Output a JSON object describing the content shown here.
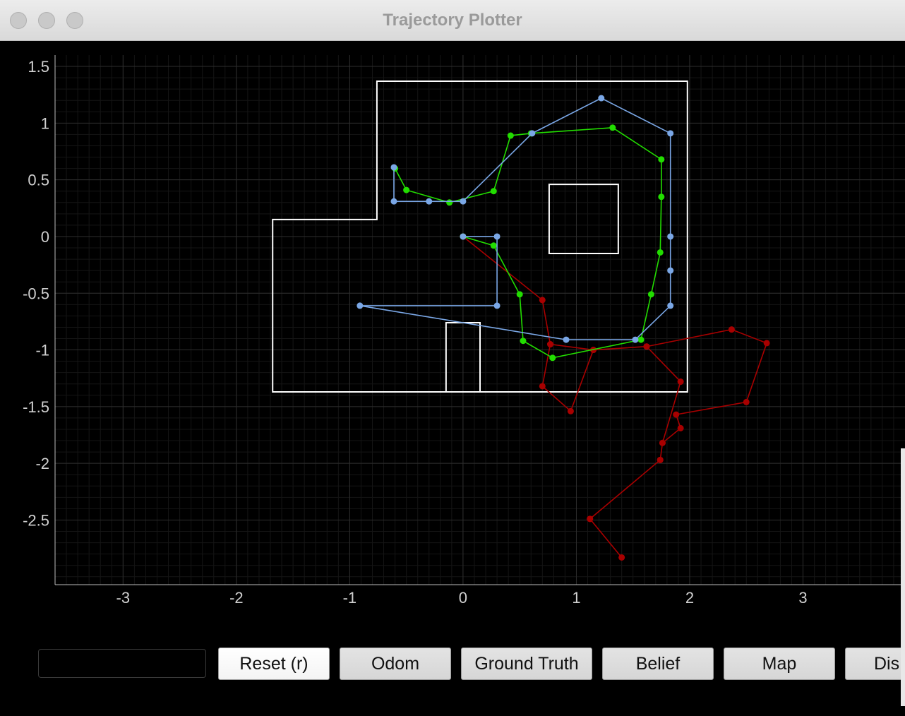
{
  "window": {
    "title": "Trajectory Plotter"
  },
  "status_field": {
    "value": ""
  },
  "buttons": [
    {
      "name": "reset-button",
      "label": "Reset (r)"
    },
    {
      "name": "odom-button",
      "label": "Odom"
    },
    {
      "name": "ground-truth-button",
      "label": "Ground Truth"
    },
    {
      "name": "belief-button",
      "label": "Belief"
    },
    {
      "name": "map-button",
      "label": "Map"
    },
    {
      "name": "dist-button",
      "label": "Dis"
    }
  ],
  "colors": {
    "background": "#000000",
    "grid": "#2e2e2e",
    "axis": "#bdbdbd",
    "odom": "#a80000",
    "ground_truth": "#22dd00",
    "belief": "#7aa7e6",
    "map": "#ffffff"
  },
  "chart_data": {
    "type": "line",
    "xlim": [
      -3.6,
      3.9
    ],
    "ylim": [
      -3.07,
      1.6
    ],
    "x_ticks": [
      -3,
      -2,
      -1,
      0,
      1,
      2,
      3
    ],
    "y_ticks": [
      1.5,
      1,
      0.5,
      0,
      -0.5,
      -1,
      -1.5,
      -2,
      -2.5
    ],
    "x_tick_labels": [
      "-3",
      "-2",
      "-1",
      "0",
      "1",
      "2",
      "3"
    ],
    "y_tick_labels": [
      "1.5",
      "1",
      "0.5",
      "0",
      "-0.5",
      "-1",
      "-1.5",
      "-2",
      "-2.5"
    ],
    "grid": true,
    "series": [
      {
        "key": "odom",
        "points": [
          [
            0,
            0
          ],
          [
            0.7,
            -0.56
          ],
          [
            0.77,
            -0.95
          ],
          [
            1.15,
            -1.0
          ],
          [
            1.62,
            -0.97
          ],
          [
            2.37,
            -0.82
          ],
          [
            2.68,
            -0.94
          ],
          [
            2.5,
            -1.46
          ],
          [
            1.88,
            -1.57
          ],
          [
            1.92,
            -1.69
          ],
          [
            1.76,
            -1.82
          ],
          [
            1.74,
            -1.97
          ],
          [
            1.12,
            -2.49
          ],
          [
            1.4,
            -2.83
          ],
          [
            1.12,
            -2.49
          ],
          [
            1.74,
            -1.97
          ],
          [
            1.76,
            -1.82
          ],
          [
            1.92,
            -1.28
          ],
          [
            1.62,
            -0.97
          ],
          [
            1.15,
            -1.0
          ],
          [
            0.95,
            -1.54
          ],
          [
            0.7,
            -1.32
          ],
          [
            0.77,
            -0.95
          ]
        ]
      },
      {
        "key": "ground_truth",
        "points": [
          [
            0,
            0
          ],
          [
            0.27,
            -0.08
          ],
          [
            0.5,
            -0.51
          ],
          [
            0.53,
            -0.92
          ],
          [
            0.79,
            -1.07
          ],
          [
            1.57,
            -0.91
          ],
          [
            1.66,
            -0.51
          ],
          [
            1.74,
            -0.14
          ],
          [
            1.75,
            0.35
          ],
          [
            1.75,
            0.68
          ],
          [
            1.32,
            0.96
          ],
          [
            0.6,
            0.91
          ],
          [
            0.42,
            0.89
          ],
          [
            0.27,
            0.4
          ],
          [
            -0.12,
            0.3
          ],
          [
            -0.5,
            0.41
          ],
          [
            -0.6,
            0.6
          ]
        ]
      },
      {
        "key": "belief",
        "points": [
          [
            0,
            0
          ],
          [
            0.3,
            0
          ],
          [
            0.3,
            -0.61
          ],
          [
            -0.91,
            -0.61
          ],
          [
            0.91,
            -0.91
          ],
          [
            1.52,
            -0.91
          ],
          [
            1.83,
            -0.61
          ],
          [
            1.83,
            -0.3
          ],
          [
            1.83,
            0
          ],
          [
            1.83,
            0.91
          ],
          [
            1.22,
            1.22
          ],
          [
            0.61,
            0.91
          ],
          [
            0,
            0.31
          ],
          [
            -0.3,
            0.31
          ],
          [
            -0.61,
            0.31
          ],
          [
            -0.61,
            0.61
          ]
        ]
      }
    ],
    "map_polygons": [
      [
        [
          -1.68,
          -1.37
        ],
        [
          1.98,
          -1.37
        ],
        [
          1.98,
          1.37
        ],
        [
          -0.76,
          1.37
        ],
        [
          -0.76,
          0.15
        ],
        [
          -1.68,
          0.15
        ]
      ],
      [
        [
          0.76,
          -0.15
        ],
        [
          1.37,
          -0.15
        ],
        [
          1.37,
          0.46
        ],
        [
          0.76,
          0.46
        ]
      ],
      [
        [
          -0.15,
          -1.37
        ],
        [
          0.15,
          -1.37
        ],
        [
          0.15,
          -0.76
        ],
        [
          -0.15,
          -0.76
        ]
      ]
    ]
  }
}
